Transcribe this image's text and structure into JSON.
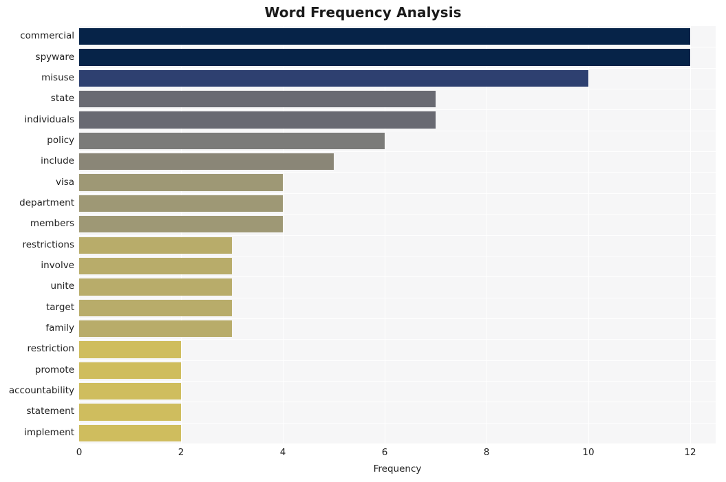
{
  "chart_data": {
    "type": "bar",
    "orientation": "horizontal",
    "title": "Word Frequency Analysis",
    "xlabel": "Frequency",
    "ylabel": "",
    "xlim": [
      0,
      12.5
    ],
    "xticks": [
      0,
      2,
      4,
      6,
      8,
      10,
      12
    ],
    "xticklabels": [
      "0",
      "2",
      "4",
      "6",
      "8",
      "10",
      "12"
    ],
    "grid": true,
    "legend": null,
    "categories": [
      "commercial",
      "spyware",
      "misuse",
      "state",
      "individuals",
      "policy",
      "include",
      "visa",
      "department",
      "members",
      "restrictions",
      "involve",
      "unite",
      "target",
      "family",
      "restriction",
      "promote",
      "accountability",
      "statement",
      "implement"
    ],
    "values": [
      12,
      12,
      10,
      7,
      7,
      6,
      5,
      4,
      4,
      4,
      3,
      3,
      3,
      3,
      3,
      2,
      2,
      2,
      2,
      2
    ],
    "bar_colors": [
      "#062348",
      "#062348",
      "#2e4070",
      "#696a72",
      "#696a72",
      "#7b7b79",
      "#8a8677",
      "#9e9875",
      "#9e9875",
      "#9e9875",
      "#b8ac6a",
      "#b8ac6a",
      "#b8ac6a",
      "#b8ac6a",
      "#b8ac6a",
      "#cfbd5e",
      "#cfbd5e",
      "#cfbd5e",
      "#cfbd5e",
      "#cfbd5e"
    ],
    "plot_background": "#f6f6f7",
    "figure_background": "#ffffff",
    "gridline_color": "#ffffff",
    "text_color": "#1f1f1f"
  }
}
